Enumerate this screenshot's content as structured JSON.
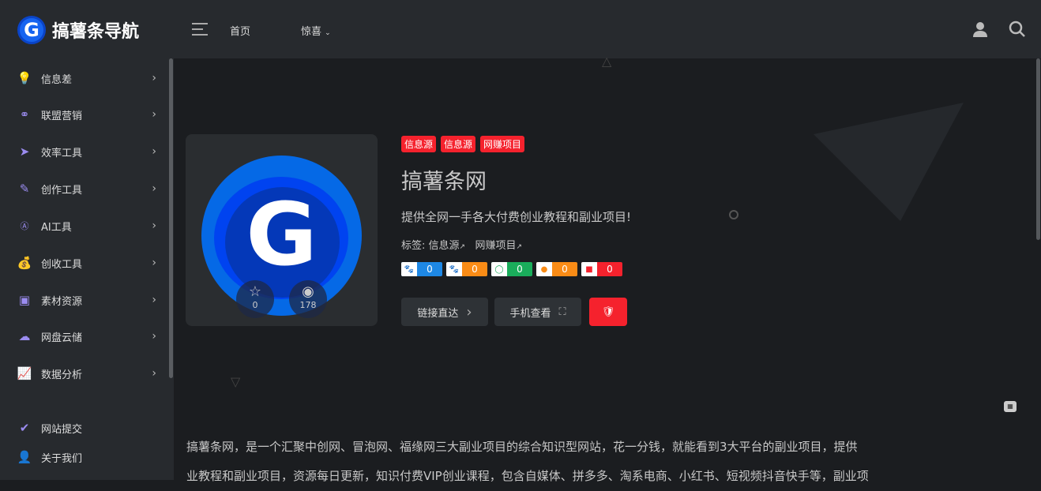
{
  "header": {
    "logo_letter": "G",
    "site_name": "搞薯条导航",
    "nav": [
      "首页",
      "惊喜"
    ]
  },
  "sidebar": {
    "items": [
      {
        "label": "信息差",
        "icon": "bulb-icon"
      },
      {
        "label": "联盟营销",
        "icon": "network-icon"
      },
      {
        "label": "效率工具",
        "icon": "send-icon"
      },
      {
        "label": "创作工具",
        "icon": "pen-icon"
      },
      {
        "label": "AI工具",
        "icon": "ai-icon"
      },
      {
        "label": "创收工具",
        "icon": "money-bag-icon"
      },
      {
        "label": "素材资源",
        "icon": "image-icon"
      },
      {
        "label": "网盘云储",
        "icon": "cloud-icon"
      },
      {
        "label": "数据分析",
        "icon": "chart-icon"
      }
    ],
    "bottom": [
      {
        "label": "网站提交",
        "icon": "check-circle-icon"
      },
      {
        "label": "关于我们",
        "icon": "user-icon"
      }
    ]
  },
  "site": {
    "logo_letter": "G",
    "favorites": "0",
    "views": "178",
    "categories": [
      "信息源",
      "信息源",
      "网赚项目"
    ],
    "title": "搞薯条网",
    "description": "提供全网一手各大付费创业教程和副业项目!",
    "tags_label": "标签:",
    "tags": [
      "信息源",
      "网赚项目"
    ],
    "rankings": [
      {
        "icon": "baidu-icon",
        "value": "0",
        "color": "#1e88e5"
      },
      {
        "icon": "sogou-icon",
        "value": "0",
        "color": "#fa8c16"
      },
      {
        "icon": "360-icon",
        "value": "0",
        "color": "#1aad5b"
      },
      {
        "icon": "shenma-icon",
        "value": "0",
        "color": "#fa8c16"
      },
      {
        "icon": "toutiao-icon",
        "value": "0",
        "color": "#f5222d"
      }
    ],
    "buttons": {
      "visit": "链接直达",
      "mobile": "手机查看"
    }
  },
  "article": {
    "lines": [
      "搞薯条网，是一个汇聚中创网、冒泡网、福缘网三大副业项目的综合知识型网站，花一分钱，就能看到3大平台的副业项目，提供",
      "业教程和副业项目，资源每日更新，知识付费VIP创业课程，包含自媒体、拼多多、淘系电商、小红书、短视频抖音快手等，副业项"
    ]
  }
}
